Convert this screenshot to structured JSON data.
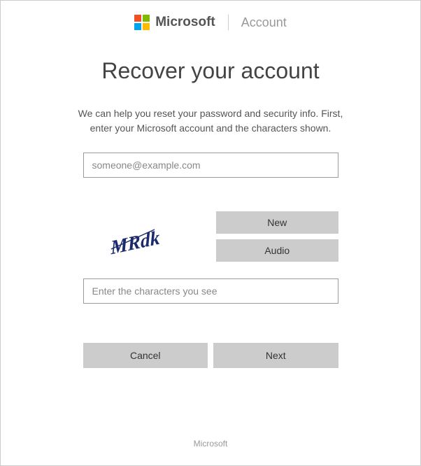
{
  "header": {
    "brand": "Microsoft",
    "section": "Account"
  },
  "main": {
    "title": "Recover your account",
    "instructions": "We can help you reset your password and security info. First, enter your Microsoft account and the characters shown.",
    "email_placeholder": "someone@example.com",
    "captcha_text": "MRdk",
    "new_label": "New",
    "audio_label": "Audio",
    "captcha_placeholder": "Enter the characters you see",
    "cancel_label": "Cancel",
    "next_label": "Next"
  },
  "footer": {
    "text": "Microsoft"
  }
}
